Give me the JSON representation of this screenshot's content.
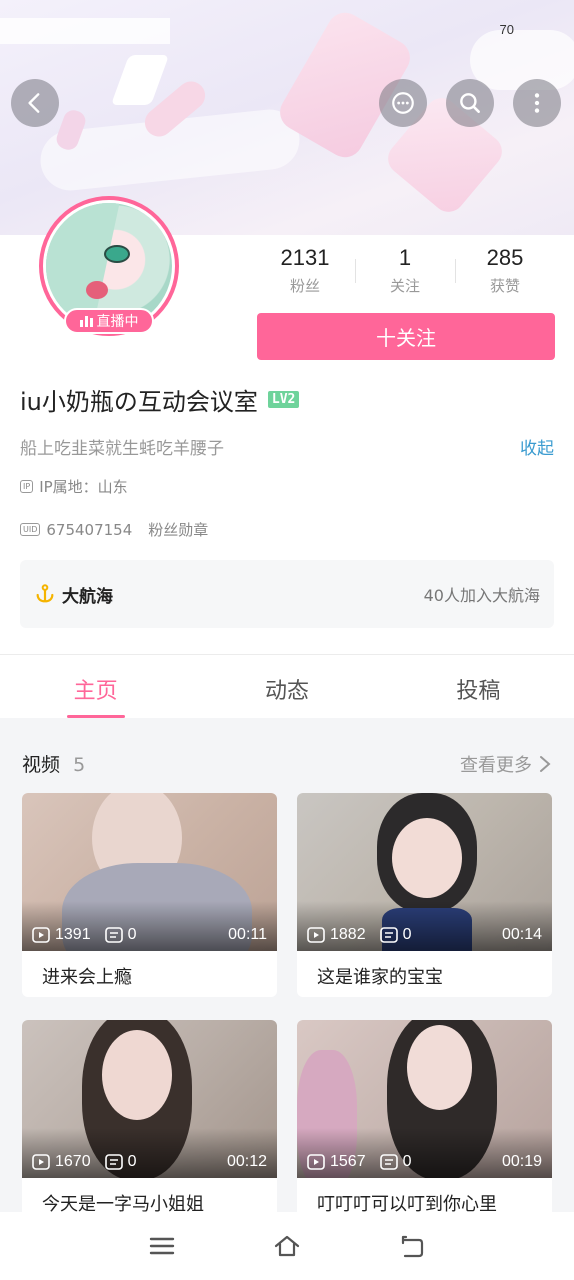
{
  "status_bar": {
    "battery": "70"
  },
  "header": {
    "back_icon": "chevron-left-icon",
    "chat_icon": "chat-bubble-icon",
    "search_icon": "search-icon",
    "more_icon": "more-vertical-icon"
  },
  "profile": {
    "live_label": "直播中",
    "stats": [
      {
        "value": "2131",
        "label": "粉丝"
      },
      {
        "value": "1",
        "label": "关注"
      },
      {
        "value": "285",
        "label": "获赞"
      }
    ],
    "follow_label": "十关注",
    "name": "iu小奶瓶の互动会议室",
    "level": "LV2",
    "signature": "船上吃韭菜就生蚝吃羊腰子",
    "collapse_label": "收起",
    "ip_tag": "IP",
    "ip_location": "IP属地：山东",
    "uid_tag": "UID",
    "uid": "675407154",
    "fans_medal": "粉丝勋章",
    "fleet_title": "大航海",
    "fleet_count": "40人加入大航海"
  },
  "tabs": [
    {
      "label": "主页",
      "active": true
    },
    {
      "label": "动态",
      "active": false
    },
    {
      "label": "投稿",
      "active": false
    }
  ],
  "videos": {
    "title": "视频",
    "count": "5",
    "see_more": "查看更多",
    "items": [
      {
        "plays": "1391",
        "comments": "0",
        "duration": "00:11",
        "title": "进来会上瘾"
      },
      {
        "plays": "1882",
        "comments": "0",
        "duration": "00:14",
        "title": "这是谁家的宝宝"
      },
      {
        "plays": "1670",
        "comments": "0",
        "duration": "00:12",
        "title": "今天是一字马小姐姐"
      },
      {
        "plays": "1567",
        "comments": "0",
        "duration": "00:19",
        "title": "叮叮叮可以叮到你心里"
      }
    ]
  },
  "colors": {
    "accent": "#ff6699",
    "link": "#3a9bd0",
    "level_badge": "#6fd39b"
  },
  "system_nav": {
    "menu_icon": "menu-icon",
    "home_icon": "home-icon",
    "back_icon": "back-icon"
  }
}
